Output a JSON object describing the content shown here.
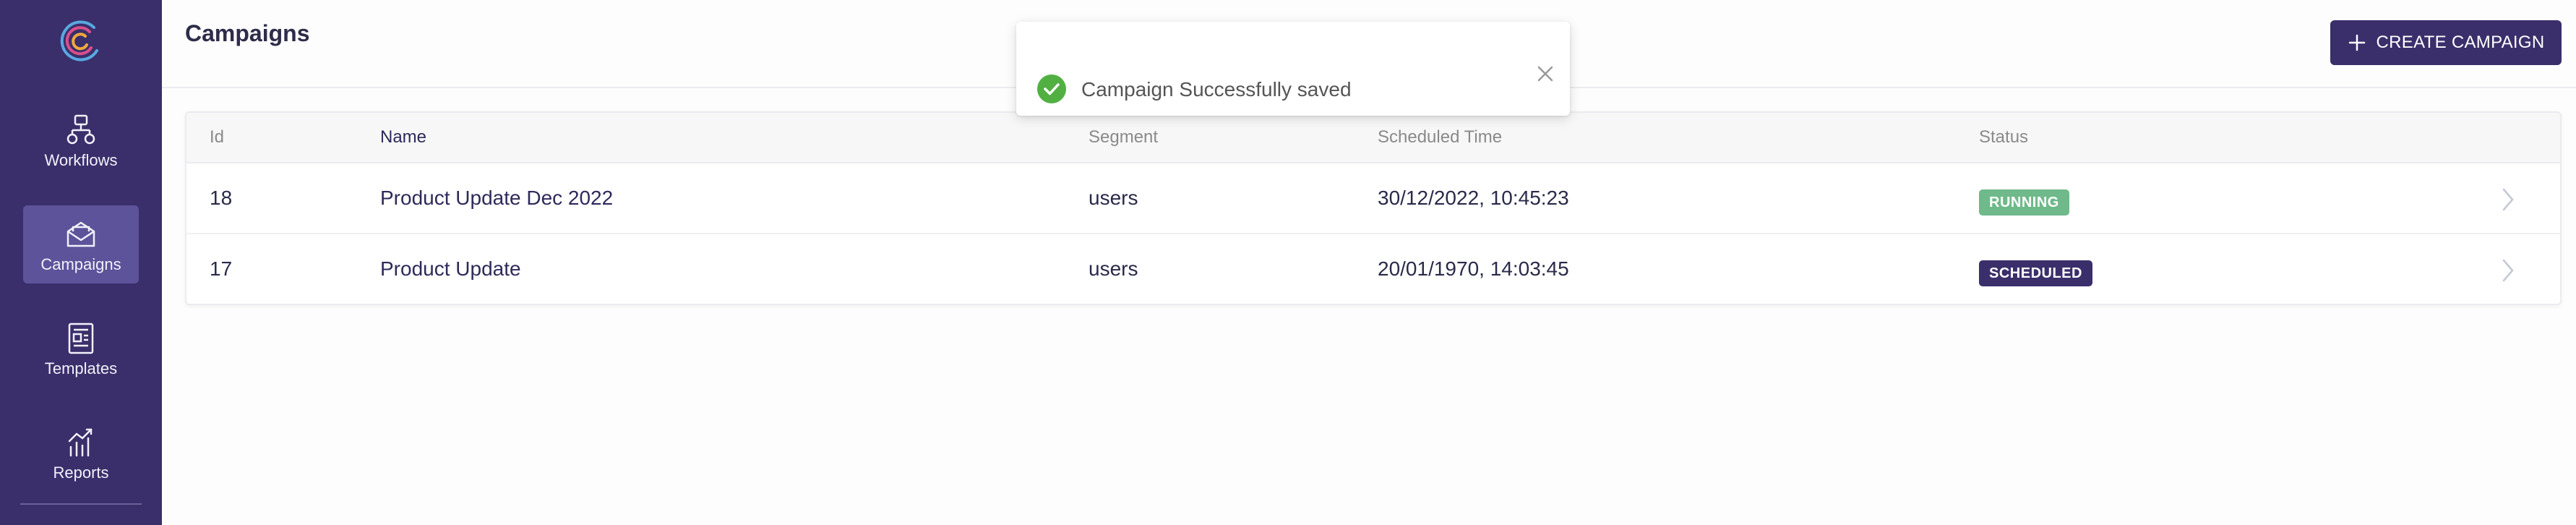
{
  "sidebar": {
    "items": [
      {
        "label": "Workflows",
        "icon": "workflow-icon"
      },
      {
        "label": "Campaigns",
        "icon": "envelope-icon",
        "active": true
      },
      {
        "label": "Templates",
        "icon": "template-icon"
      },
      {
        "label": "Reports",
        "icon": "chart-icon"
      }
    ]
  },
  "header": {
    "title": "Campaigns",
    "create_label": "CREATE CAMPAIGN"
  },
  "toast": {
    "message": "Campaign Successfully saved"
  },
  "table": {
    "columns": [
      "Id",
      "Name",
      "Segment",
      "Scheduled Time",
      "Status"
    ],
    "rows": [
      {
        "id": "18",
        "name": "Product Update Dec 2022",
        "segment": "users",
        "time": "30/12/2022, 10:45:23",
        "status": "RUNNING"
      },
      {
        "id": "17",
        "name": "Product Update",
        "segment": "users",
        "time": "20/01/1970, 14:03:45",
        "status": "SCHEDULED"
      }
    ]
  },
  "colors": {
    "sidebar_bg": "#3a2f6b",
    "active_item_bg": "#5c539a",
    "running": "#6fb98a",
    "scheduled": "#3a2f6b",
    "success": "#52b043"
  }
}
